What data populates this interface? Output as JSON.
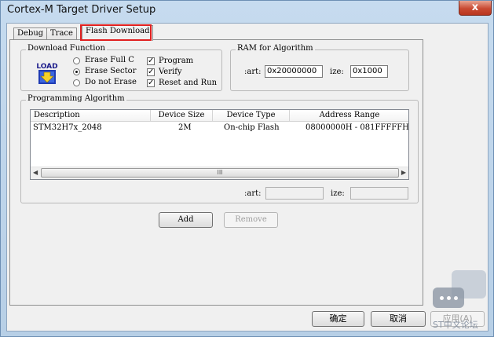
{
  "window": {
    "title": "Cortex-M Target Driver Setup",
    "close": "x"
  },
  "tabs": [
    "Debug",
    "Trace",
    "Flash Download"
  ],
  "download_function": {
    "title": "Download Function",
    "icon_label": "LOAD",
    "radios": [
      {
        "label": "Erase Full C",
        "checked": false
      },
      {
        "label": "Erase Sector",
        "checked": true
      },
      {
        "label": "Do not Erase",
        "checked": false
      }
    ],
    "checkboxes": [
      {
        "label": "Program",
        "checked": true
      },
      {
        "label": "Verify",
        "checked": true
      },
      {
        "label": "Reset and Run",
        "checked": true
      }
    ]
  },
  "ram": {
    "title": "RAM for Algorithm",
    "start_label": ":art:",
    "start_value": "0x20000000",
    "size_label": "ize:",
    "size_value": "0x1000"
  },
  "programming": {
    "title": "Programming Algorithm",
    "columns": [
      "Description",
      "Device Size",
      "Device Type",
      "Address Range"
    ],
    "rows": [
      [
        "STM32H7x_2048",
        "2M",
        "On-chip Flash",
        "08000000H - 081FFFFFH"
      ]
    ],
    "scroll_grip": "III",
    "start_label": ":art:",
    "size_label": "ize:",
    "start_value": "",
    "size_value": ""
  },
  "buttons": {
    "add": "Add",
    "remove": "Remove",
    "ok": "确定",
    "cancel": "取消",
    "apply": "应用(A)"
  },
  "watermark": "ST中文论坛"
}
